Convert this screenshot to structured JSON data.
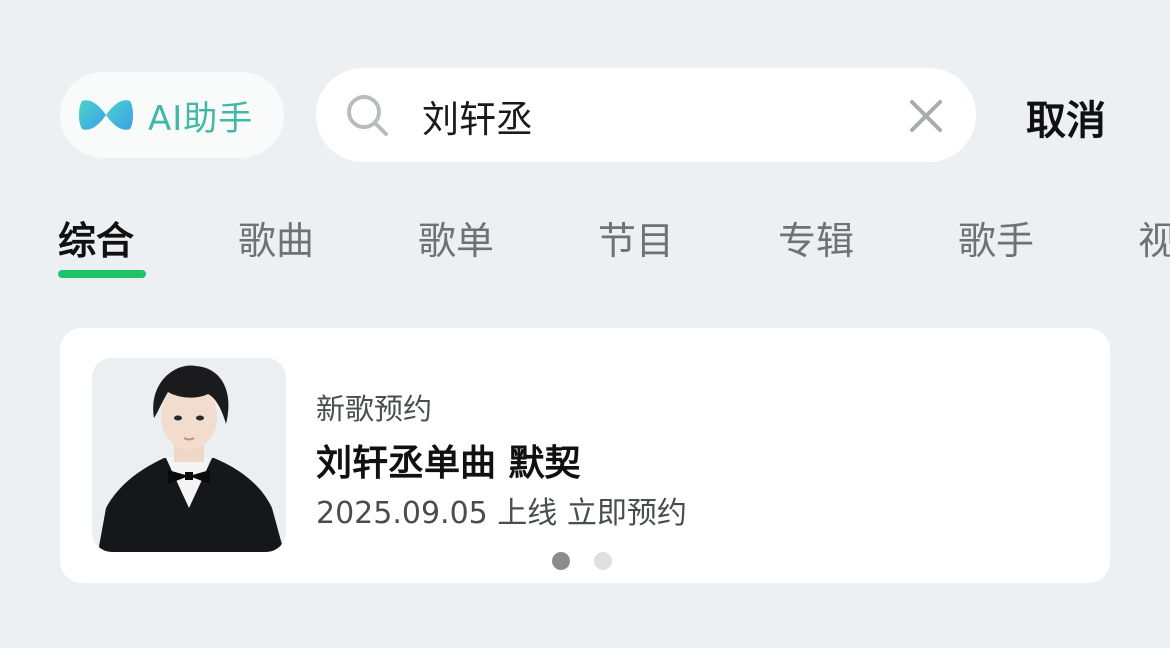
{
  "top_bar": {
    "ai_assistant_label": "AI助手",
    "search_query": "刘轩丞",
    "cancel_label": "取消",
    "brand_colors": {
      "ai_gradient_start": "#4ed3c8",
      "ai_gradient_end": "#3aa0ea",
      "ai_text": "#3fb9a5"
    }
  },
  "tabs": [
    {
      "label": "综合",
      "active": true
    },
    {
      "label": "歌曲",
      "active": false
    },
    {
      "label": "歌单",
      "active": false
    },
    {
      "label": "节目",
      "active": false
    },
    {
      "label": "专辑",
      "active": false
    },
    {
      "label": "歌手",
      "active": false
    },
    {
      "label": "视",
      "active": false
    }
  ],
  "accent_color": "#20c364",
  "card": {
    "kicker": "新歌预约",
    "title": "刘轩丞单曲 默契",
    "release_date": "2025.09.05 上线",
    "action": "立即预约",
    "pagination": {
      "current": 1,
      "total": 2
    }
  }
}
